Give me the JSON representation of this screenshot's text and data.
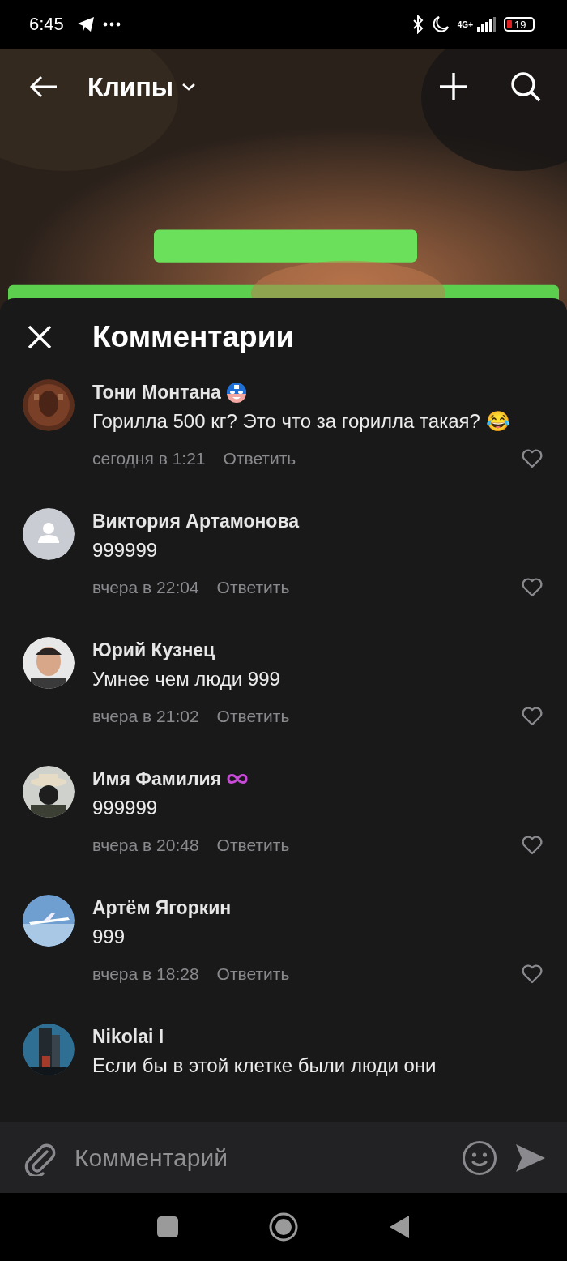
{
  "status_bar": {
    "time": "6:45",
    "network": "4G+",
    "battery": "19"
  },
  "header": {
    "title": "Клипы"
  },
  "comments_sheet": {
    "title": "Комментарии",
    "comments": [
      {
        "author": "Тони Монтана",
        "badge": {
          "kind": "mask"
        },
        "avatar": {
          "kind": "texture"
        },
        "text": "Горилла 500 кг? Это что за горилла такая? 😂",
        "time": "сегодня в 1:21",
        "reply": "Ответить",
        "liked": false
      },
      {
        "author": "Виктория Артамонова",
        "avatar": {
          "kind": "default"
        },
        "text": "999999",
        "time": "вчера в 22:04",
        "reply": "Ответить",
        "liked": false
      },
      {
        "author": "Юрий Кузнец",
        "avatar": {
          "kind": "person"
        },
        "text": "Умнее чем люди 999",
        "time": "вчера в 21:02",
        "reply": "Ответить",
        "liked": false
      },
      {
        "author": "Имя Фамилия",
        "badge": {
          "kind": "infinity"
        },
        "avatar": {
          "kind": "hat"
        },
        "text": "999999",
        "time": "вчера в 20:48",
        "reply": "Ответить",
        "liked": false
      },
      {
        "author": "Артём Ягоркин",
        "avatar": {
          "kind": "plane"
        },
        "text": "999",
        "time": "вчера в 18:28",
        "reply": "Ответить",
        "liked": false
      },
      {
        "author": "Nikolai I",
        "avatar": {
          "kind": "tower"
        },
        "text": "Если бы в этой клетке были люди они"
      }
    ]
  },
  "composer": {
    "placeholder": "Комментарий"
  }
}
